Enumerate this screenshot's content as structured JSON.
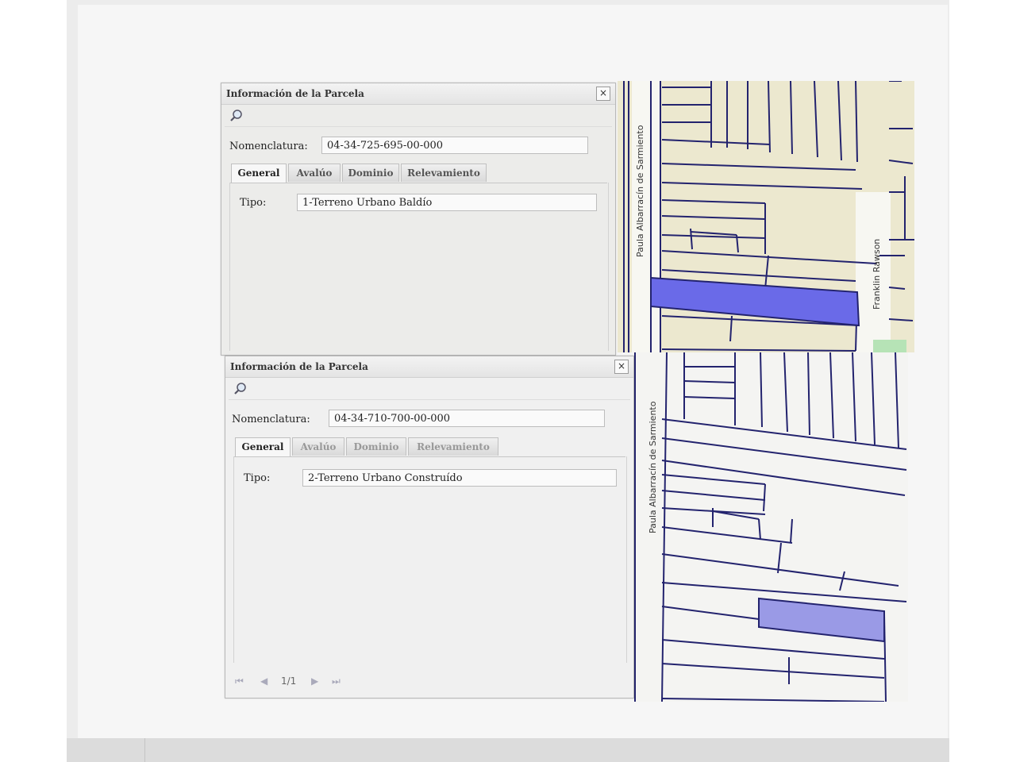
{
  "colors": {
    "parcel_line": "#23236e",
    "highlight": "#6a6ae8",
    "highlight_light": "#9a9ae6",
    "map_top_bg": "#ece8cf",
    "green_patch": "#b6e3b6"
  },
  "panel_top": {
    "title": "Información de la Parcela",
    "close_label": "×",
    "nomenclatura_label": "Nomenclatura:",
    "nomenclatura_value": "04-34-725-695-00-000",
    "tabs": [
      "General",
      "Avalúo",
      "Dominio",
      "Relevamiento"
    ],
    "active_tab": "General",
    "tipo_label": "Tipo:",
    "tipo_value": "1-Terreno Urbano Baldío"
  },
  "panel_bottom": {
    "title": "Información de la Parcela",
    "close_label": "×",
    "nomenclatura_label": "Nomenclatura:",
    "nomenclatura_value": "04-34-710-700-00-000",
    "tabs": [
      "General",
      "Avalúo",
      "Dominio",
      "Relevamiento"
    ],
    "active_tab": "General",
    "tipo_label": "Tipo:",
    "tipo_value": "2-Terreno Urbano Construído",
    "pager": {
      "first": "⏮",
      "prev": "◀",
      "page": "1/1",
      "next": "▶",
      "last": "⏭"
    }
  },
  "map_top": {
    "street_left": "Paula Albarracín de Sarmiento",
    "street_right": "Franklin Rawson"
  },
  "map_bottom": {
    "street_left": "Paula Albarracín de Sarmiento"
  }
}
